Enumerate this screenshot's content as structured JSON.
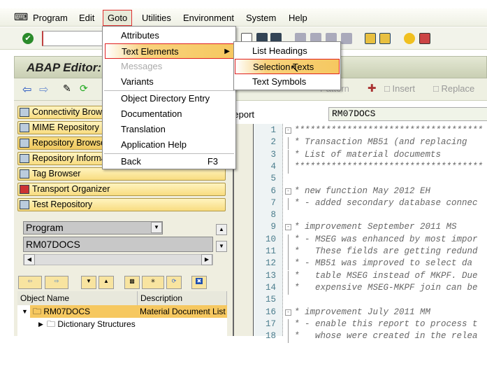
{
  "menubar": {
    "items": [
      "Program",
      "Edit",
      "Goto",
      "Utilities",
      "Environment",
      "System",
      "Help"
    ],
    "active": "Goto"
  },
  "title": "ABAP Editor:",
  "app_toolbar": {
    "pattern": "Pattern",
    "insert": "Insert",
    "replace": "Replace"
  },
  "goto_menu": {
    "items": [
      {
        "label": "Attributes"
      },
      {
        "label": "Text Elements",
        "submenu": true,
        "highlighted": true
      },
      {
        "label": "Messages",
        "disabled": true
      },
      {
        "label": "Variants"
      },
      {
        "label": "Object Directory Entry"
      },
      {
        "label": "Documentation"
      },
      {
        "label": "Translation"
      },
      {
        "label": "Application Help"
      },
      {
        "label": "Back",
        "shortcut": "F3"
      }
    ]
  },
  "text_elements_submenu": {
    "items": [
      "List Headings",
      "Selection Texts",
      "Text Symbols"
    ],
    "highlighted": "Selection Texts"
  },
  "navigator": {
    "buttons": [
      "Connectivity Browser",
      "MIME Repository",
      "Repository Browser",
      "Repository Information System",
      "Tag Browser",
      "Transport Organizer",
      "Test Repository"
    ],
    "object_type": "Program",
    "object_name": "RM07DOCS",
    "tree": {
      "columns": [
        "Object Name",
        "Description"
      ],
      "rows": [
        {
          "name": "RM07DOCS",
          "description": "Material Document List"
        },
        {
          "name": "Dictionary Structures",
          "description": ""
        }
      ]
    }
  },
  "editor": {
    "report_label": "Report",
    "report_name": "RM07DOCS",
    "lines": [
      "************************************",
      "* Transaction MB51 (and replacing",
      "* List of material documemts",
      "************************************",
      "",
      "* new function May 2012 EH",
      "* - added secondary database connec",
      "",
      "* improvement September 2011 MS",
      "* - MSEG was enhanced by most impor",
      "*   These fields are getting redund",
      "* - MB51 was improved to select da",
      "*   table MSEG instead of MKPF. Due",
      "*   expensive MSEG-MKPF join can be",
      "",
      "* improvement July 2011 MM",
      "* - enable this report to process t",
      "*   whose were created in the relea"
    ]
  },
  "colors": {
    "highlight": "#f6c860",
    "red_outline": "#e02020",
    "nav_button": "#f8dc80"
  }
}
